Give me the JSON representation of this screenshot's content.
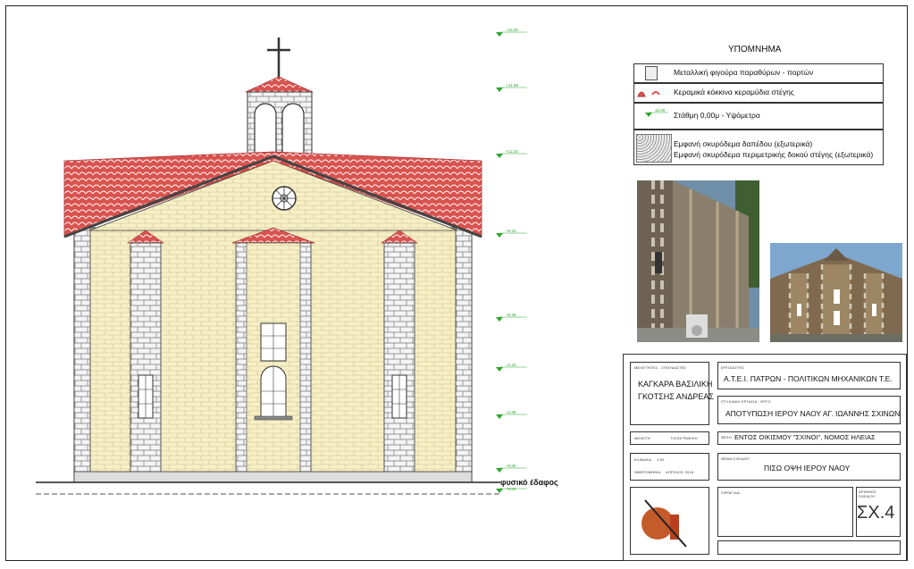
{
  "legend": {
    "title": "ΥΠΟΜΝΗΜΑ",
    "items": [
      {
        "icon": "window-frame-icon",
        "text": "Μεταλλική φιγούρα παραθύρων - πορτών"
      },
      {
        "icon": "roof-tile-icon",
        "text": "Κεραμικά κόκκινα κεραμύδια στέγης"
      },
      {
        "icon": "level-marker-icon",
        "icon_text": "±0.00",
        "text": "Στάθμη 0,00μ - Υψόμετρα"
      },
      {
        "icon": "concrete-texture-icon",
        "text": "Εμφανή σκυρόδεμα δαπέδου (εξωτερικά)",
        "text2": "Εμφανή σκυρόδεμα περιμετρικής δοκού στέγης (εξωτερικά)"
      }
    ]
  },
  "drawing": {
    "levels": [
      "+15.00",
      "+14.08",
      "+12.25",
      "+9.34",
      "+6.26",
      "+4.43",
      "+3.38",
      "+0.80",
      "+0.00"
    ],
    "ground_label": "φυσικό έδαφος",
    "colors": {
      "roof": "#d9534f",
      "wall": "#f6efc4",
      "stone": "#f3f3f3",
      "level": "#2da82d"
    }
  },
  "titleblock": {
    "designers_label": "ΜΕΛΕΤΗΤΕΣ - ΣΠΟΥΔΑΣΤΕΣ",
    "designer1": "ΚΑΓΚΑΡΑ ΒΑΣΙΛΙΚΗ",
    "designer2": "ΓΚΟΤΣΗΣ ΑΝΔΡΕΑΣ",
    "client_label": "ΕΡΓΟΔΟΤΗΣ",
    "client": "Α.Τ.Ε.Ι. ΠΑΤΡΩΝ - ΠΟΛΙΤΙΚΩΝ ΜΗΧΑΝΙΚΩΝ Τ.Ε.",
    "project_label": "ΠΤΥΧΙΑΚΗ ΕΡΓΑΣΙΑ - ΕΡΓΟ",
    "project": "ΑΠΟΤΥΠΩΣΗ ΙΕΡΟΥ ΝΑΟΥ ΑΓ. ΙΩΑΝΝΗΣ ΣΧΙΝΩΝ",
    "study_label": "ΜΕΛΕΤΗ",
    "study_value": "ΤΟΠΟΓΡΑΦΙΚΗ",
    "location_label": "ΘΕΣΗ",
    "location": "ΕΝΤΟΣ ΟΙΚΙΣΜΟΥ \"ΣΧΙΝΟΙ\", ΝΟΜΟΣ ΗΛΕΙΑΣ",
    "scale_label": "ΚΛΙΜΑΚΑ",
    "scale_value": "1:50",
    "date_label": "ΗΜΕΡΟΜΗΝΙΑ",
    "date_value": "ΑΠΡΙΛΙΟΣ 2018",
    "subject_label": "ΘΕΜΑ ΣΧΕΔΙΟΥ",
    "subject": "ΠΙΣΩ ΟΨΗ ΙΕΡΟΥ ΝΑΟΥ",
    "stamp_label": "ΣΦΡΑΓΙΔΑ",
    "sheet_no_label": "ΑΡΙΘΜΟΣ ΣΧΕΔΙΟΥ",
    "sheet_no": "ΣΧ.4"
  }
}
